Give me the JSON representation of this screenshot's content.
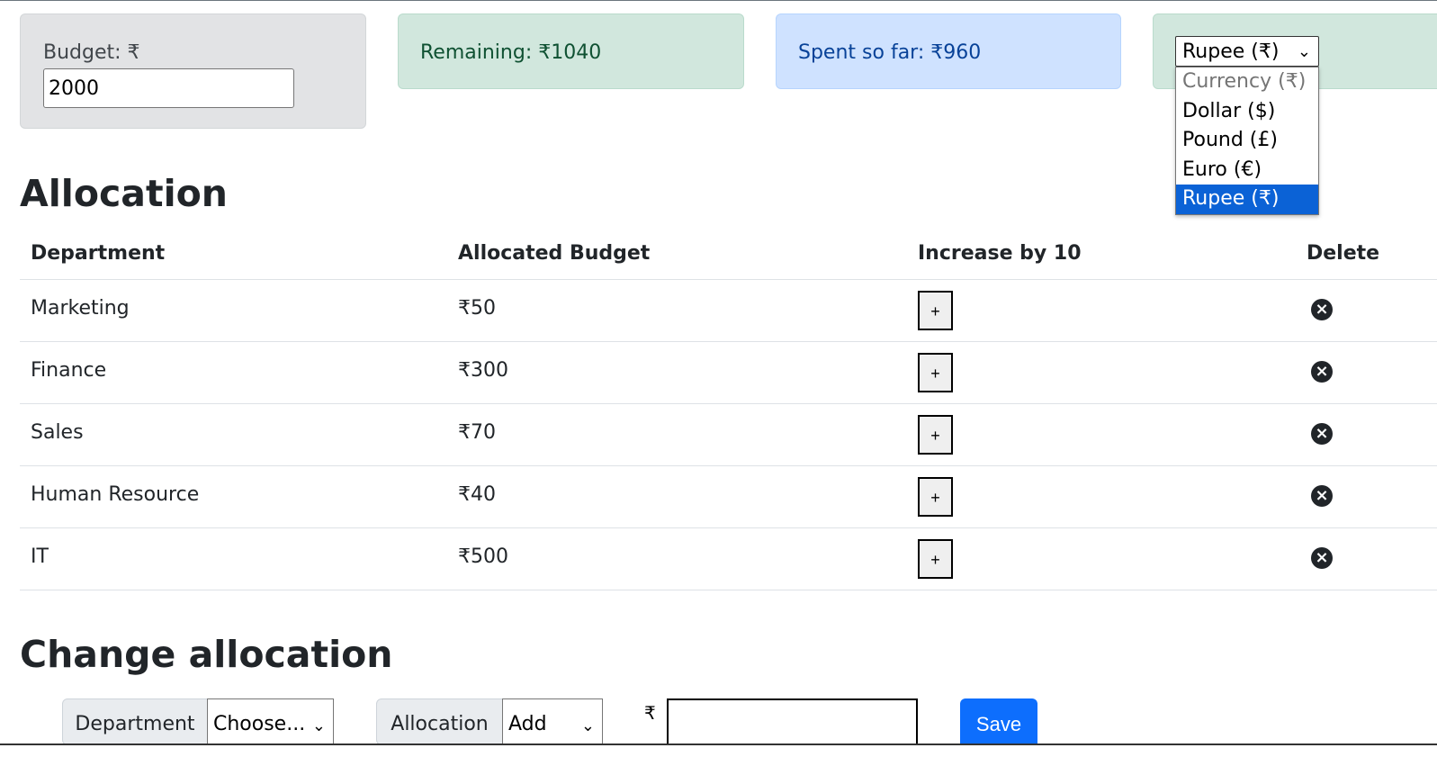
{
  "budget": {
    "label": "Budget: ₹",
    "value": "2000"
  },
  "remaining": {
    "text": "Remaining: ₹1040"
  },
  "spent": {
    "text": "Spent so far: ₹960"
  },
  "currency": {
    "selected_label": "Rupee (₹)",
    "options": [
      {
        "label": "Currency (₹)",
        "state": "placeholder"
      },
      {
        "label": "Dollar ($)",
        "state": "normal"
      },
      {
        "label": "Pound (£)",
        "state": "normal"
      },
      {
        "label": "Euro (€)",
        "state": "normal"
      },
      {
        "label": "Rupee (₹)",
        "state": "highlighted"
      }
    ],
    "highlight_color": "#0b62d6"
  },
  "allocation": {
    "heading": "Allocation",
    "columns": [
      "Department",
      "Allocated Budget",
      "Increase by 10",
      "Delete"
    ],
    "rows": [
      {
        "department": "Marketing",
        "budget": "₹50",
        "increase_label": "+"
      },
      {
        "department": "Finance",
        "budget": "₹300",
        "increase_label": "+"
      },
      {
        "department": "Sales",
        "budget": "₹70",
        "increase_label": "+"
      },
      {
        "department": "Human Resource",
        "budget": "₹40",
        "increase_label": "+"
      },
      {
        "department": "IT",
        "budget": "₹500",
        "increase_label": "+"
      }
    ],
    "delete_icon": "x-circle-icon"
  },
  "change_allocation": {
    "heading": "Change allocation",
    "department_label": "Department",
    "department_select": "Choose...",
    "allocation_label": "Allocation",
    "allocation_select": "Add",
    "currency_symbol": "₹",
    "cost_value": "",
    "save_label": "Save",
    "save_color": "#0d6efd"
  },
  "colors": {
    "remaining_bg": "#d1e7dd",
    "spent_bg": "#cfe2ff",
    "budget_bg": "#e2e3e5"
  }
}
